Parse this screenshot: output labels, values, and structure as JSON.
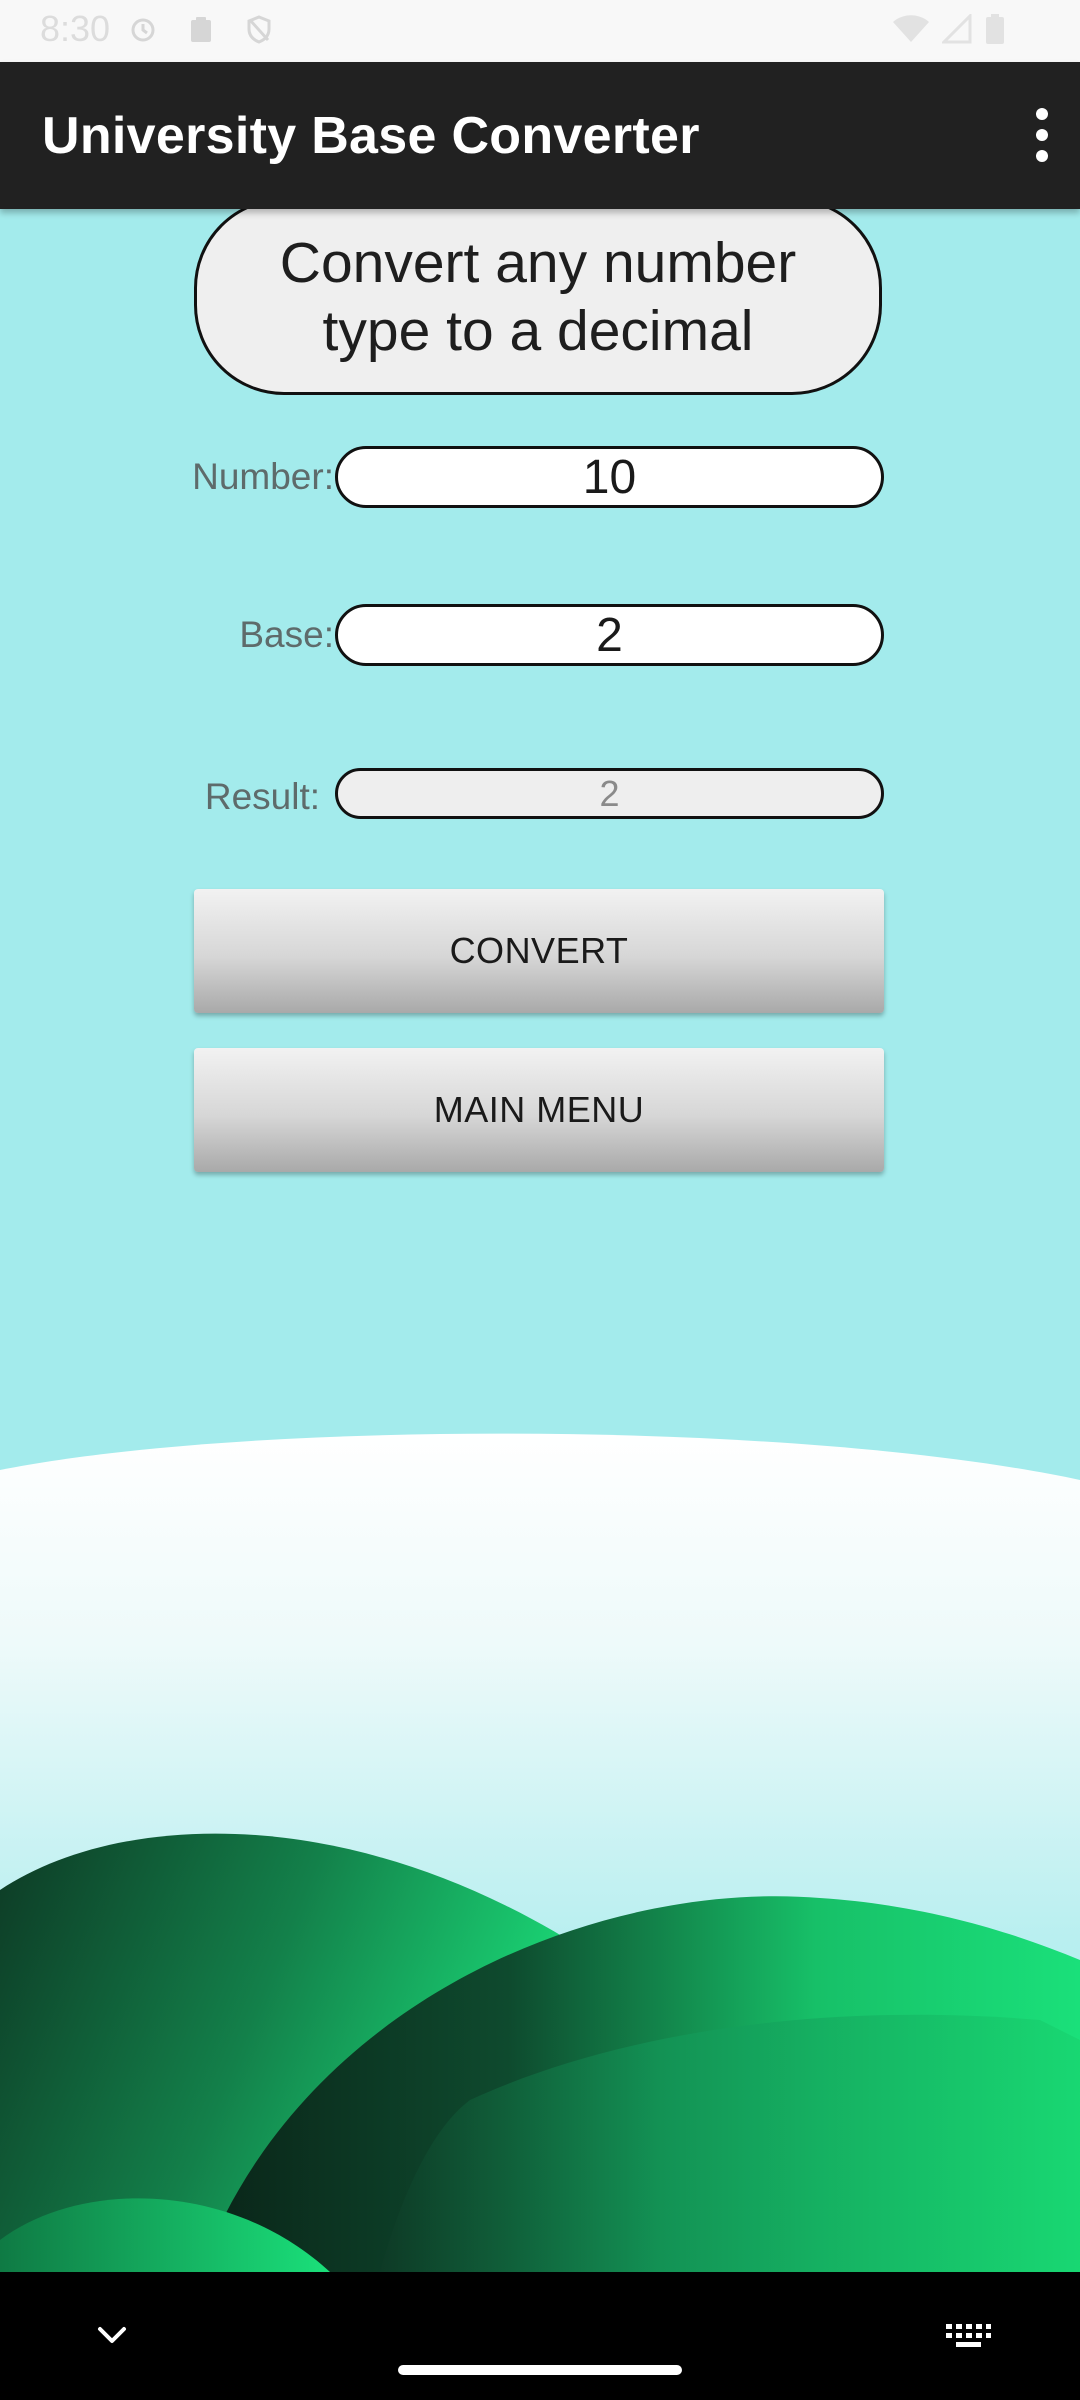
{
  "status_bar": {
    "time": "8:30"
  },
  "app_bar": {
    "title": "University Base Converter"
  },
  "heading": "Convert any number type to a decimal",
  "form": {
    "number_label": "Number:",
    "number_value": "10",
    "base_label": "Base:",
    "base_value": "2",
    "result_label": "Result:",
    "result_value": "2"
  },
  "buttons": {
    "convert_label": "CONVERT",
    "main_menu_label": "MAIN MENU"
  },
  "colors": {
    "background": "#a3ebec",
    "app_bar": "#212121",
    "hill_green": "#17dc74"
  },
  "icons": {
    "overflow": "more-vert-icon",
    "nav_back": "chevron-down-icon",
    "nav_keyboard": "keyboard-icon"
  }
}
